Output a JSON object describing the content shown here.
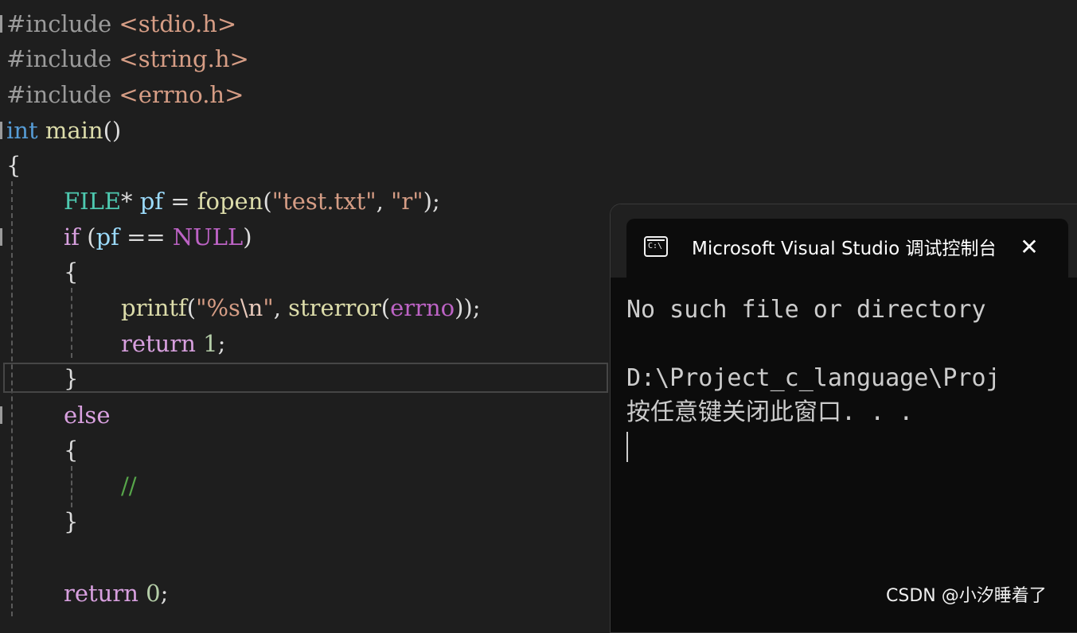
{
  "editor": {
    "include_keyword": "#include",
    "headers": [
      "<stdio.h>",
      "<string.h>",
      "<errno.h>"
    ],
    "main_return_type": "int",
    "main_name": "main",
    "main_parens": "()",
    "open_brace": "{",
    "close_brace": "}",
    "file_type": "FILE",
    "pointer_op": "*",
    "var_pf": "pf",
    "assign_op": "=",
    "fopen_fn": "fopen",
    "paren_open": "(",
    "paren_close": ")",
    "fopen_arg1": "\"test.txt\"",
    "comma": ",",
    "fopen_arg2": "\"r\"",
    "semicolon": ";",
    "if_kw": "if",
    "eq_op": "==",
    "null_macro": "NULL",
    "printf_fn": "printf",
    "fmt_string_part1": "\"%s",
    "fmt_escape": "\\n",
    "fmt_string_part2": "\"",
    "strerror_fn": "strerror",
    "errno_macro": "errno",
    "return_kw": "return",
    "return_one": "1",
    "else_kw": "else",
    "comment": "//",
    "return_zero": "0"
  },
  "console": {
    "title": "Microsoft Visual Studio 调试控制台",
    "close_glyph": "✕",
    "icon_text": "C:\\",
    "output_line1": "No such file or directory",
    "output_line2": "D:\\Project_c_language\\Proj",
    "output_line3": "按任意键关闭此窗口. . ."
  },
  "watermark": "CSDN @小汐睡着了"
}
